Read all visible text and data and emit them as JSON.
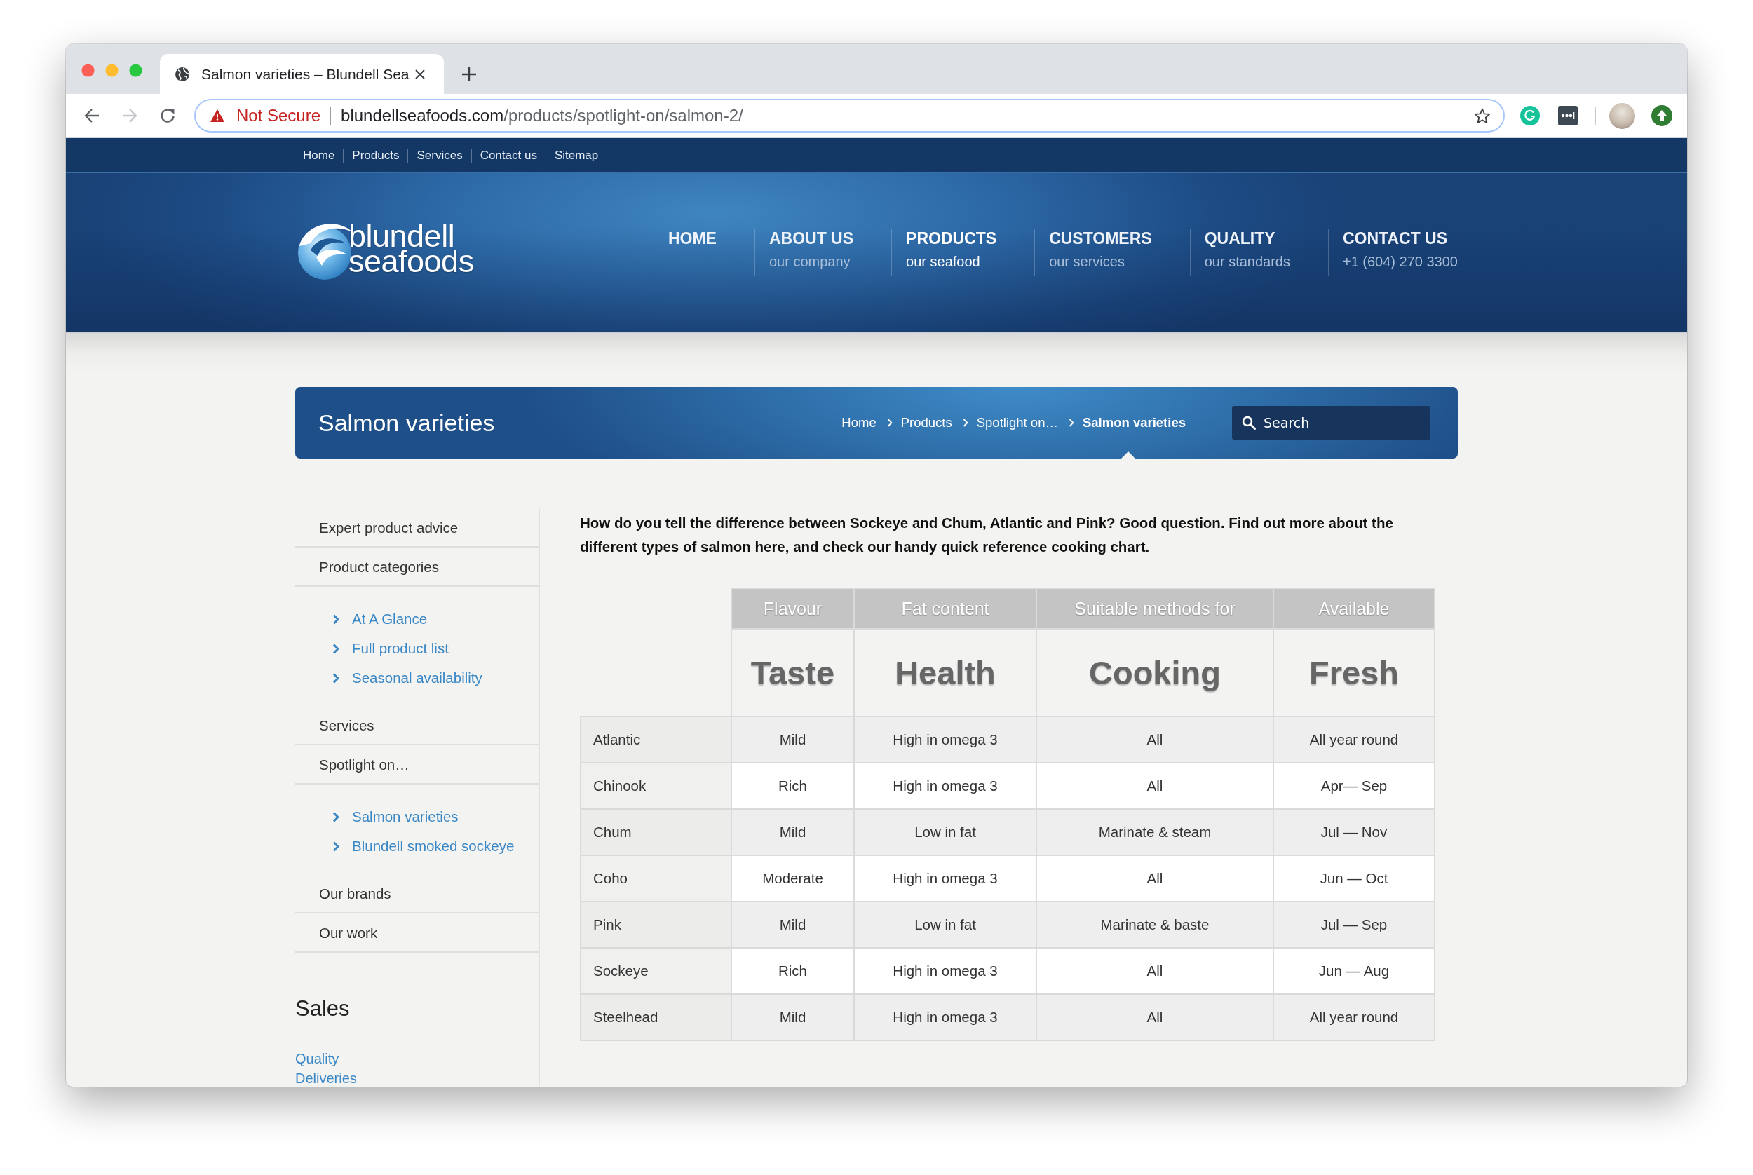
{
  "browser": {
    "tabs": [
      {
        "title": "Salmon varieties – Blundell Sea",
        "selected": true
      }
    ],
    "nav_buttons": [
      {
        "kind": "back",
        "disabled": false
      },
      {
        "kind": "forward",
        "disabled": true
      },
      {
        "kind": "reload",
        "disabled": false
      }
    ],
    "address": {
      "security": "Not Secure",
      "host": "blundellseafoods.com",
      "path": "/products/spotlight-on/salmon-2/"
    }
  },
  "top_links": [
    "Home",
    "Products",
    "Services",
    "Contact us",
    "Sitemap"
  ],
  "header": {
    "logo": {
      "line_1": "blundell",
      "line_2": "seafoods"
    },
    "menu": [
      {
        "label": "HOME",
        "selected": false
      },
      {
        "label": "ABOUT US",
        "sub": "our company",
        "selected": false
      },
      {
        "label": "PRODUCTS",
        "sub": "our seafood",
        "selected": true
      },
      {
        "label": "CUSTOMERS",
        "sub": "our services",
        "selected": false
      },
      {
        "label": "QUALITY",
        "sub": "our standards",
        "selected": false
      },
      {
        "label": "CONTACT US",
        "sub": "+1 (604) 270 3300",
        "selected": false
      }
    ]
  },
  "title_bar": {
    "title": "Salmon varieties",
    "breadcrumb": [
      {
        "label": "Home",
        "kind": "link"
      },
      {
        "label": "Products",
        "kind": "link"
      },
      {
        "label": "Spotlight on…",
        "kind": "link"
      },
      {
        "label": "Salmon varieties",
        "kind": "current"
      }
    ],
    "search": {
      "placeholder": "Search"
    }
  },
  "sidebar": {
    "items": [
      {
        "label": "Expert product advice"
      },
      {
        "label": "Product categories",
        "children": [
          {
            "label": "At A Glance"
          },
          {
            "label": "Full product list"
          },
          {
            "label": "Seasonal availability"
          }
        ]
      },
      {
        "label": "Services"
      },
      {
        "label": "Spotlight on…",
        "children": [
          {
            "label": "Salmon varieties"
          },
          {
            "label": "Blundell smoked sockeye"
          }
        ]
      },
      {
        "label": "Our brands"
      },
      {
        "label": "Our work"
      }
    ],
    "sales": {
      "heading": "Sales",
      "links": [
        "Quality",
        "Deliveries"
      ]
    }
  },
  "intro": "How do you tell the difference between Sockeye and Chum, Atlantic and Pink? Good question. Find out more about the different types of salmon here, and check our handy quick reference cooking chart.",
  "table": {
    "columns": [
      {
        "heading": "Flavour",
        "title": "Taste"
      },
      {
        "heading": "Fat content",
        "title": "Health"
      },
      {
        "heading": "Suitable methods for",
        "title": "Cooking"
      },
      {
        "heading": "Available",
        "title": "Fresh"
      }
    ],
    "rows": [
      {
        "name": "Atlantic",
        "cells": [
          "Mild",
          "High in omega 3",
          "All",
          "All year round"
        ]
      },
      {
        "name": "Chinook",
        "cells": [
          "Rich",
          "High in omega 3",
          "All",
          "Apr— Sep"
        ]
      },
      {
        "name": "Chum",
        "cells": [
          "Mild",
          "Low in fat",
          "Marinate & steam",
          "Jul — Nov"
        ]
      },
      {
        "name": "Coho",
        "cells": [
          "Moderate",
          "High in omega 3",
          "All",
          "Jun — Oct"
        ]
      },
      {
        "name": "Pink",
        "cells": [
          "Mild",
          "Low in fat",
          "Marinate & baste",
          "Jul — Sep"
        ]
      },
      {
        "name": "Sockeye",
        "cells": [
          "Rich",
          "High in omega 3",
          "All",
          "Jun — Aug"
        ]
      },
      {
        "name": "Steelhead",
        "cells": [
          "Mild",
          "High in omega 3",
          "All",
          "All year round"
        ]
      }
    ]
  }
}
